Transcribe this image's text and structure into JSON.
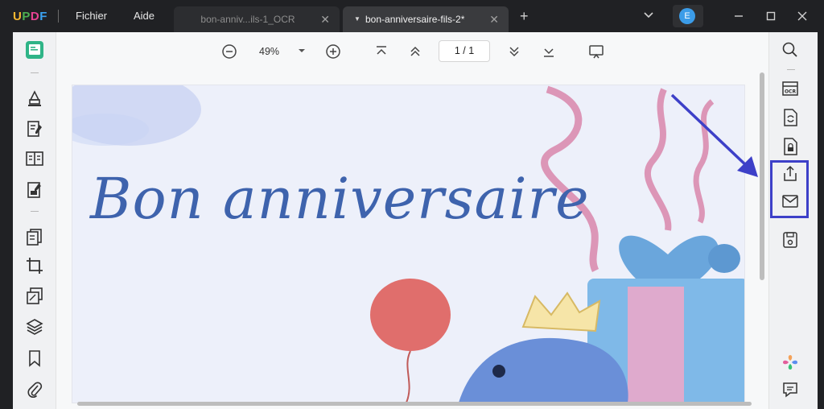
{
  "app": {
    "logo": "UPDF",
    "menus": [
      "Fichier",
      "Aide"
    ]
  },
  "tabs": [
    {
      "label": "bon-anniv...ils-1_OCR",
      "active": false
    },
    {
      "label": "bon-anniversaire-fils-2*",
      "active": true
    }
  ],
  "user": {
    "initial": "E"
  },
  "toolbar": {
    "zoom": "49%",
    "page_indicator": "1  /  1"
  },
  "document": {
    "heading": "Bon anniversaire"
  },
  "colors": {
    "accent": "#3d40c8",
    "avatar": "#3b9ce8",
    "heading": "#3e63ad"
  }
}
